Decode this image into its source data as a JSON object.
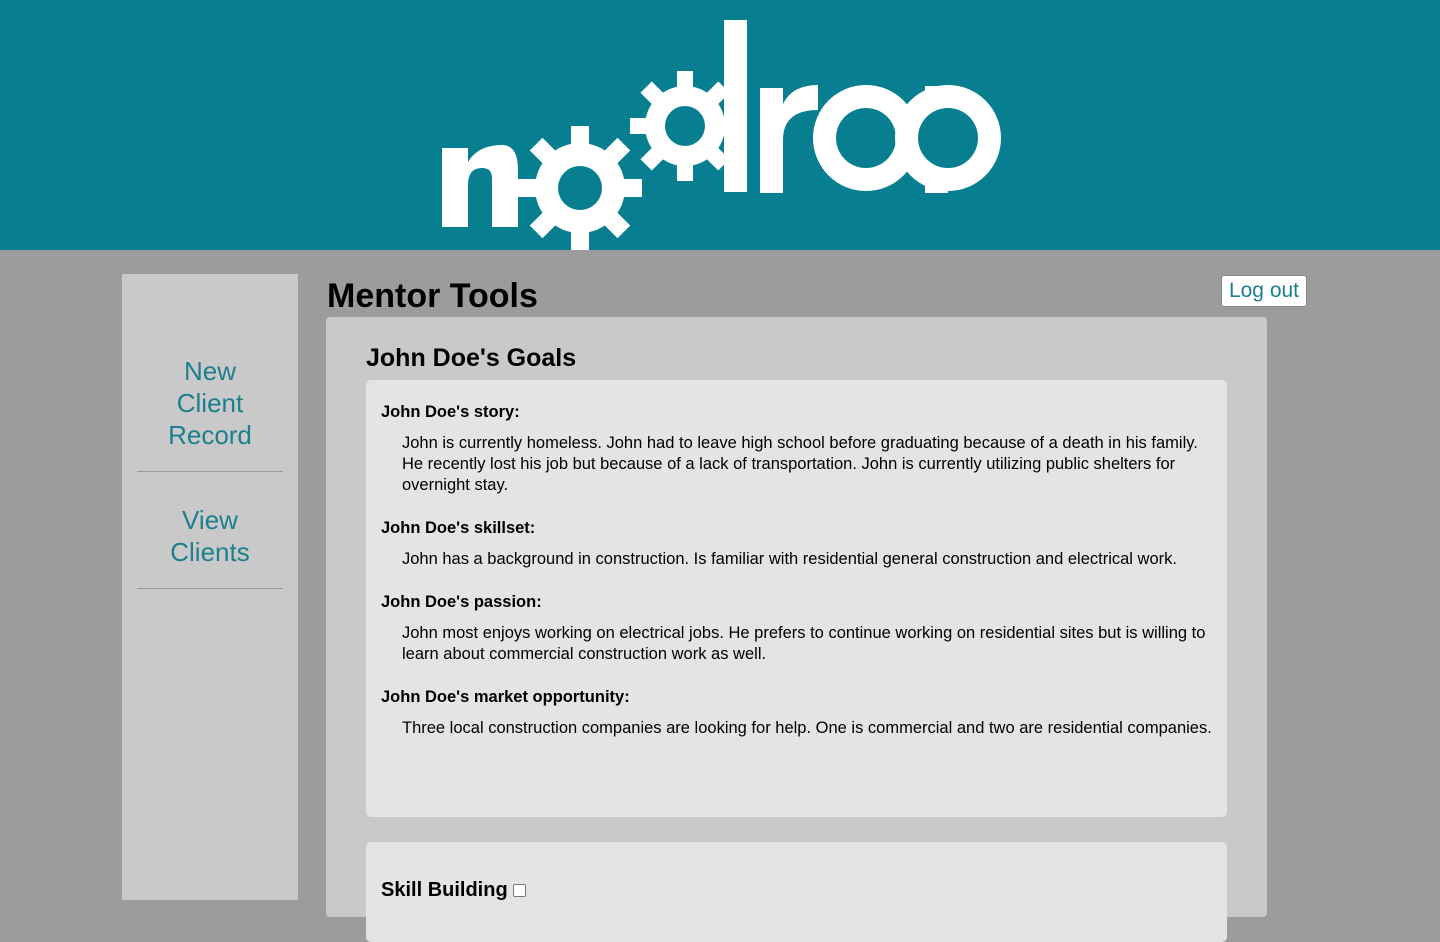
{
  "header": {
    "logo_text": "nodrop",
    "brand_color": "#077f91"
  },
  "sidebar": {
    "items": [
      {
        "label": "New Client Record"
      },
      {
        "label": "View Clients"
      }
    ]
  },
  "page": {
    "title": "Mentor Tools",
    "logout_label": "Log out"
  },
  "goals": {
    "title": "John Doe's Goals",
    "sections": [
      {
        "label": "John Doe's story:",
        "text": "John is currently homeless. John had to leave high school before graduating because of a death in his family. He recently lost his job but because of a lack of transportation. John is currently utilizing public shelters for overnight stay."
      },
      {
        "label": "John Doe's skillset:",
        "text": "John has a background in construction. Is familiar with residential general construction and electrical work."
      },
      {
        "label": "John Doe's passion:",
        "text": "John most enjoys working on electrical jobs. He prefers to continue working on residential sites but is willing to learn about commercial construction work as well."
      },
      {
        "label": "John Doe's market opportunity:",
        "text": "Three local construction companies are looking for help. One is commercial and two are residential companies."
      }
    ]
  },
  "skill_building": {
    "label": "Skill Building",
    "checked": false
  }
}
